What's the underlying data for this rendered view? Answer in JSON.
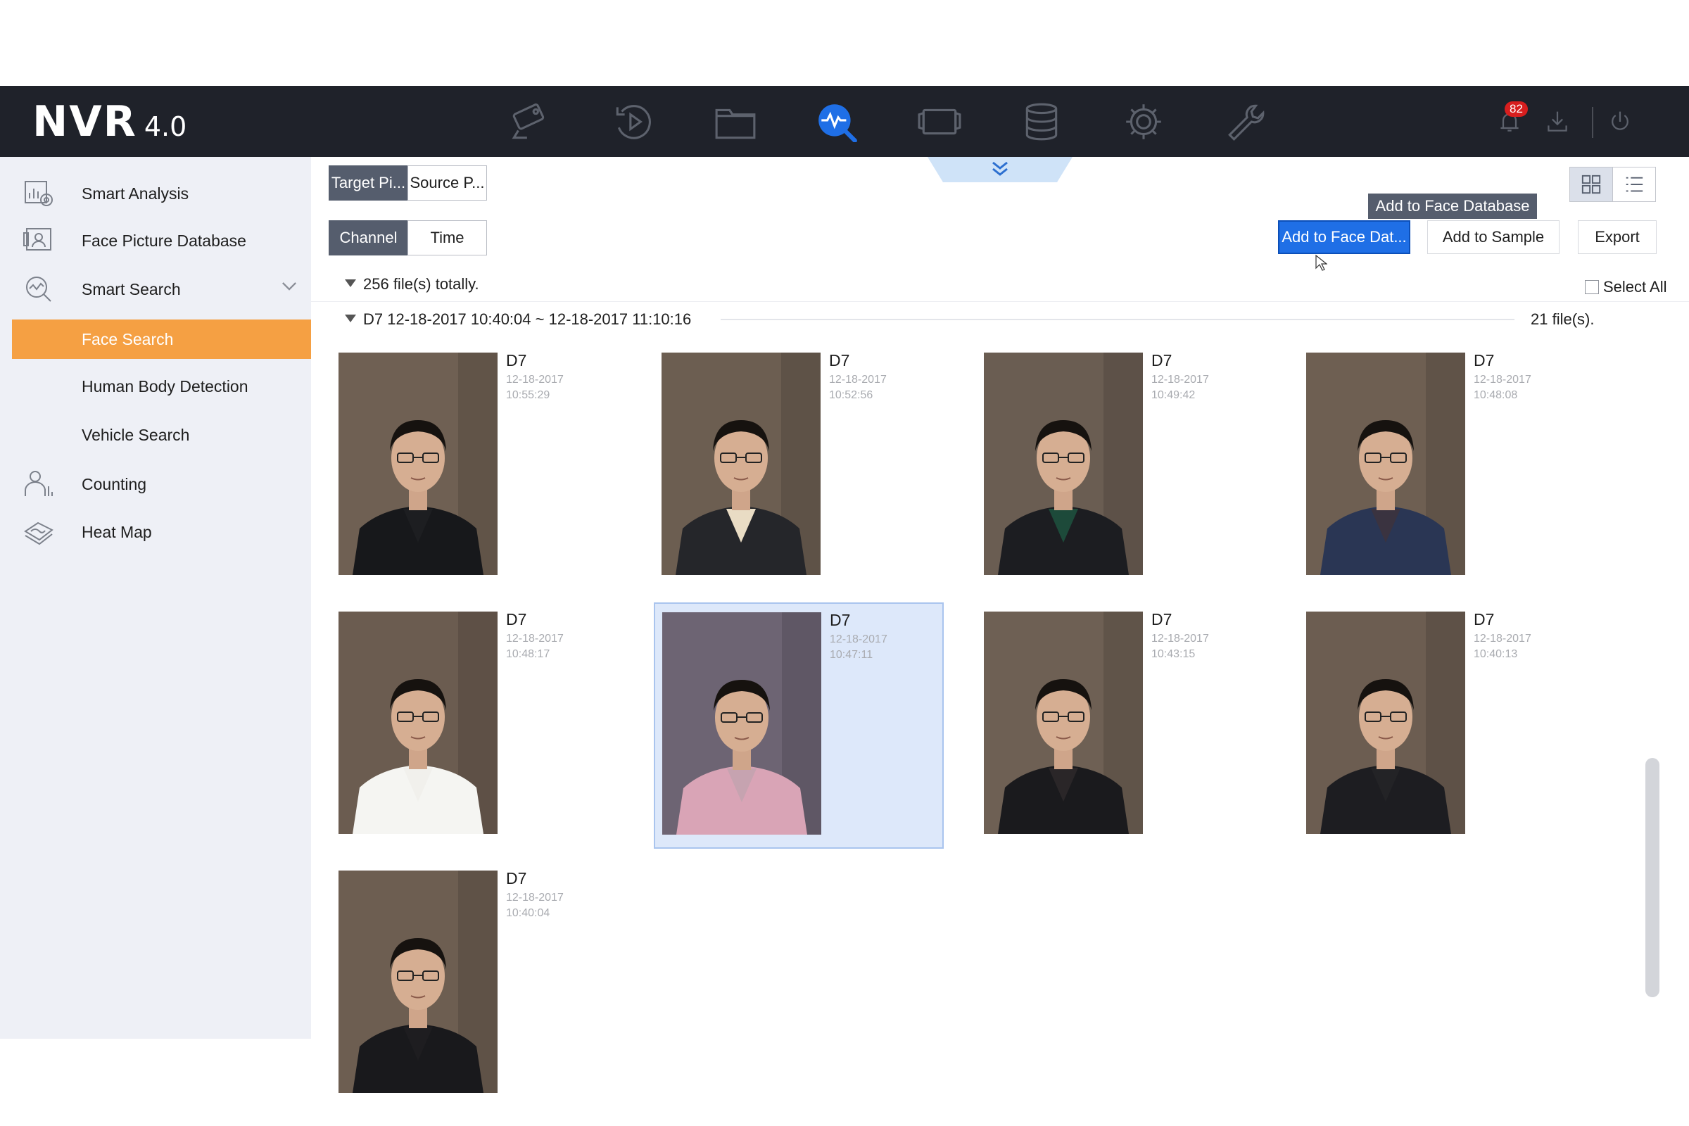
{
  "app": {
    "brand": "NVR",
    "version": "4.0",
    "notification_count": "82",
    "nav_icons": [
      "camera-icon",
      "playback-icon",
      "folder-icon",
      "smart-analysis-icon",
      "video-icon",
      "storage-icon",
      "settings-icon",
      "maintenance-icon"
    ],
    "active_nav": "smart-analysis-icon",
    "accent_color": "#f5a043",
    "primary_color": "#1f6fe6"
  },
  "sidebar": {
    "items": [
      {
        "label": "Smart Analysis",
        "icon": "smart-analysis-icon"
      },
      {
        "label": "Face Picture Database",
        "icon": "face-database-icon"
      },
      {
        "label": "Smart Search",
        "icon": "smart-search-icon"
      },
      {
        "label": "Face Search",
        "active": true
      },
      {
        "label": "Human Body Detection"
      },
      {
        "label": "Vehicle Search"
      },
      {
        "label": "Counting",
        "icon": "counting-icon"
      },
      {
        "label": "Heat Map",
        "icon": "heat-map-icon"
      }
    ]
  },
  "toolbar": {
    "mode_tabs": [
      "Target Pi...",
      "Source P..."
    ],
    "filter_tabs": [
      "Channel",
      "Time"
    ],
    "tooltip": "Add to Face Database",
    "add_face_db_label": "Add to Face Dat...",
    "add_sample_label": "Add to Sample",
    "export_label": "Export",
    "select_all_label": "Select All"
  },
  "results": {
    "total_label": "256 file(s) totally.",
    "group": {
      "label": "D7 12-18-2017 10:40:04 ~ 12-18-2017 11:10:16",
      "count_label": "21 file(s)."
    },
    "items": [
      {
        "channel": "D7",
        "date": "12-18-2017",
        "time": "10:55:29",
        "selected": false
      },
      {
        "channel": "D7",
        "date": "12-18-2017",
        "time": "10:52:56",
        "selected": false
      },
      {
        "channel": "D7",
        "date": "12-18-2017",
        "time": "10:49:42",
        "selected": false
      },
      {
        "channel": "D7",
        "date": "12-18-2017",
        "time": "10:48:08",
        "selected": false
      },
      {
        "channel": "D7",
        "date": "12-18-2017",
        "time": "10:48:17",
        "selected": false
      },
      {
        "channel": "D7",
        "date": "12-18-2017",
        "time": "10:47:11",
        "selected": true
      },
      {
        "channel": "D7",
        "date": "12-18-2017",
        "time": "10:43:15",
        "selected": false
      },
      {
        "channel": "D7",
        "date": "12-18-2017",
        "time": "10:40:13",
        "selected": false
      },
      {
        "channel": "D7",
        "date": "12-18-2017",
        "time": "10:40:04",
        "selected": false
      }
    ]
  }
}
